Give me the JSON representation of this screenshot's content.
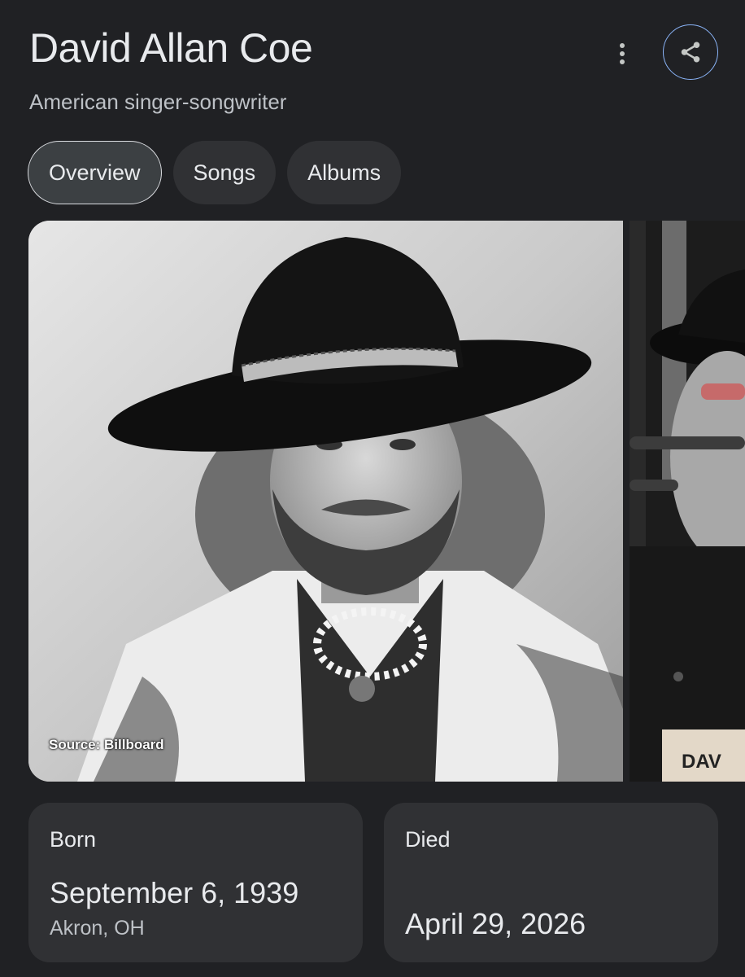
{
  "header": {
    "title": "David Allan Coe",
    "subtitle": "American singer-songwriter",
    "more_icon": "more-vert-icon",
    "share_icon": "share-icon"
  },
  "tabs": [
    {
      "label": "Overview",
      "active": true
    },
    {
      "label": "Songs",
      "active": false
    },
    {
      "label": "Albums",
      "active": false
    }
  ],
  "images": {
    "main_source": "Source: Billboard",
    "second_caption": "DAV"
  },
  "facts": {
    "born": {
      "label": "Born",
      "date": "September 6, 1939",
      "place": "Akron, OH"
    },
    "died": {
      "label": "Died",
      "date": "April 29, 2026"
    }
  },
  "colors": {
    "background": "#202124",
    "chip": "#303134",
    "accent": "#8ab4f8"
  }
}
